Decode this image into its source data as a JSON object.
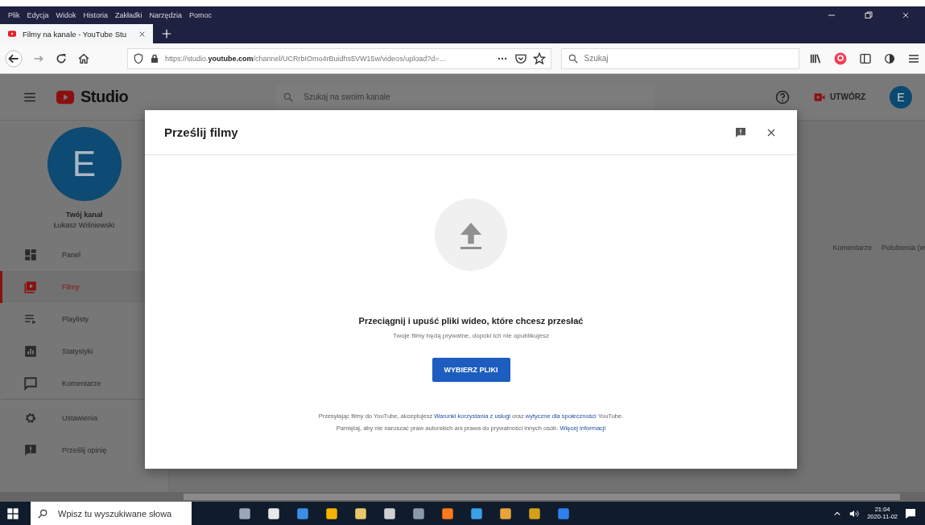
{
  "browser": {
    "menu": [
      "Plik",
      "Edycja",
      "Widok",
      "Historia",
      "Zakładki",
      "Narzędzia",
      "Pomoc"
    ],
    "tab": {
      "title": "Filmy na kanale - YouTube Stu",
      "selected": true
    },
    "url": {
      "prefix": "https://studio.",
      "domain": "youtube.com",
      "rest": "/channel/UCRrbIOmo4rBuidhs5VW15w/videos/upload?d=…"
    },
    "search": {
      "placeholder": "Szukaj"
    }
  },
  "studio": {
    "logo": "Studio",
    "search": {
      "placeholder": "Szukaj na swoim kanale"
    },
    "create": "UTWÓRZ",
    "avatar": "E"
  },
  "sidebar": {
    "avatar": "E",
    "channel": "Twój kanał",
    "owner": "Łukasz Wiśniewski",
    "items": [
      {
        "label": "Panel",
        "selected": false,
        "divider": false
      },
      {
        "label": "Filmy",
        "selected": true,
        "divider": false
      },
      {
        "label": "Playlisty",
        "selected": false,
        "divider": false
      },
      {
        "label": "Statystyki",
        "selected": false,
        "divider": false
      },
      {
        "label": "Komentarze",
        "selected": false,
        "divider": true
      },
      {
        "label": "Ustawienia",
        "selected": false,
        "divider": false
      },
      {
        "label": "Prześlij opinię",
        "selected": false,
        "divider": false
      }
    ]
  },
  "table": {
    "columns": [
      "Komentarze",
      "Polubienia (w"
    ]
  },
  "dialog": {
    "title": "Prześlij filmy",
    "heading": "Przeciągnij i upuść pliki wideo, które chcesz przesłać",
    "subtext": "Twoje filmy będą prywatne, dopóki ich nie opublikujesz",
    "button": "WYBIERZ PLIKI",
    "legal": [
      [
        {
          "kind": "text",
          "text": "Przesyłając filmy do YouTube, akceptujesz "
        },
        {
          "kind": "link",
          "text": "Warunki korzystania z usługi"
        },
        {
          "kind": "text",
          "text": " oraz "
        },
        {
          "kind": "link",
          "text": "wytyczne dla społeczności"
        },
        {
          "kind": "text",
          "text": " YouTube."
        }
      ],
      [
        {
          "kind": "text",
          "text": "Pamiętaj, aby nie naruszać praw autorskich ani prawa do prywatności innych osób. "
        },
        {
          "kind": "link",
          "text": "Więcej informacji"
        }
      ]
    ]
  },
  "taskbar": {
    "search": {
      "placeholder": "Wpisz tu wyszukiwane słowa"
    },
    "apps": [
      {
        "color": "#9aa7b8"
      },
      {
        "color": "#e8e8e8"
      },
      {
        "color": "#3a8ee6"
      },
      {
        "color": "#f4b400"
      },
      {
        "color": "#e8c86a"
      },
      {
        "color": "#d0d0d0"
      },
      {
        "color": "#8a9aa8"
      },
      {
        "color": "#ff7a1a"
      },
      {
        "color": "#3aa0e8"
      },
      {
        "color": "#e8a33a"
      },
      {
        "color": "#d4a017"
      },
      {
        "color": "#2f80ed"
      }
    ],
    "time": "21:04",
    "date": "2020-11-02"
  }
}
